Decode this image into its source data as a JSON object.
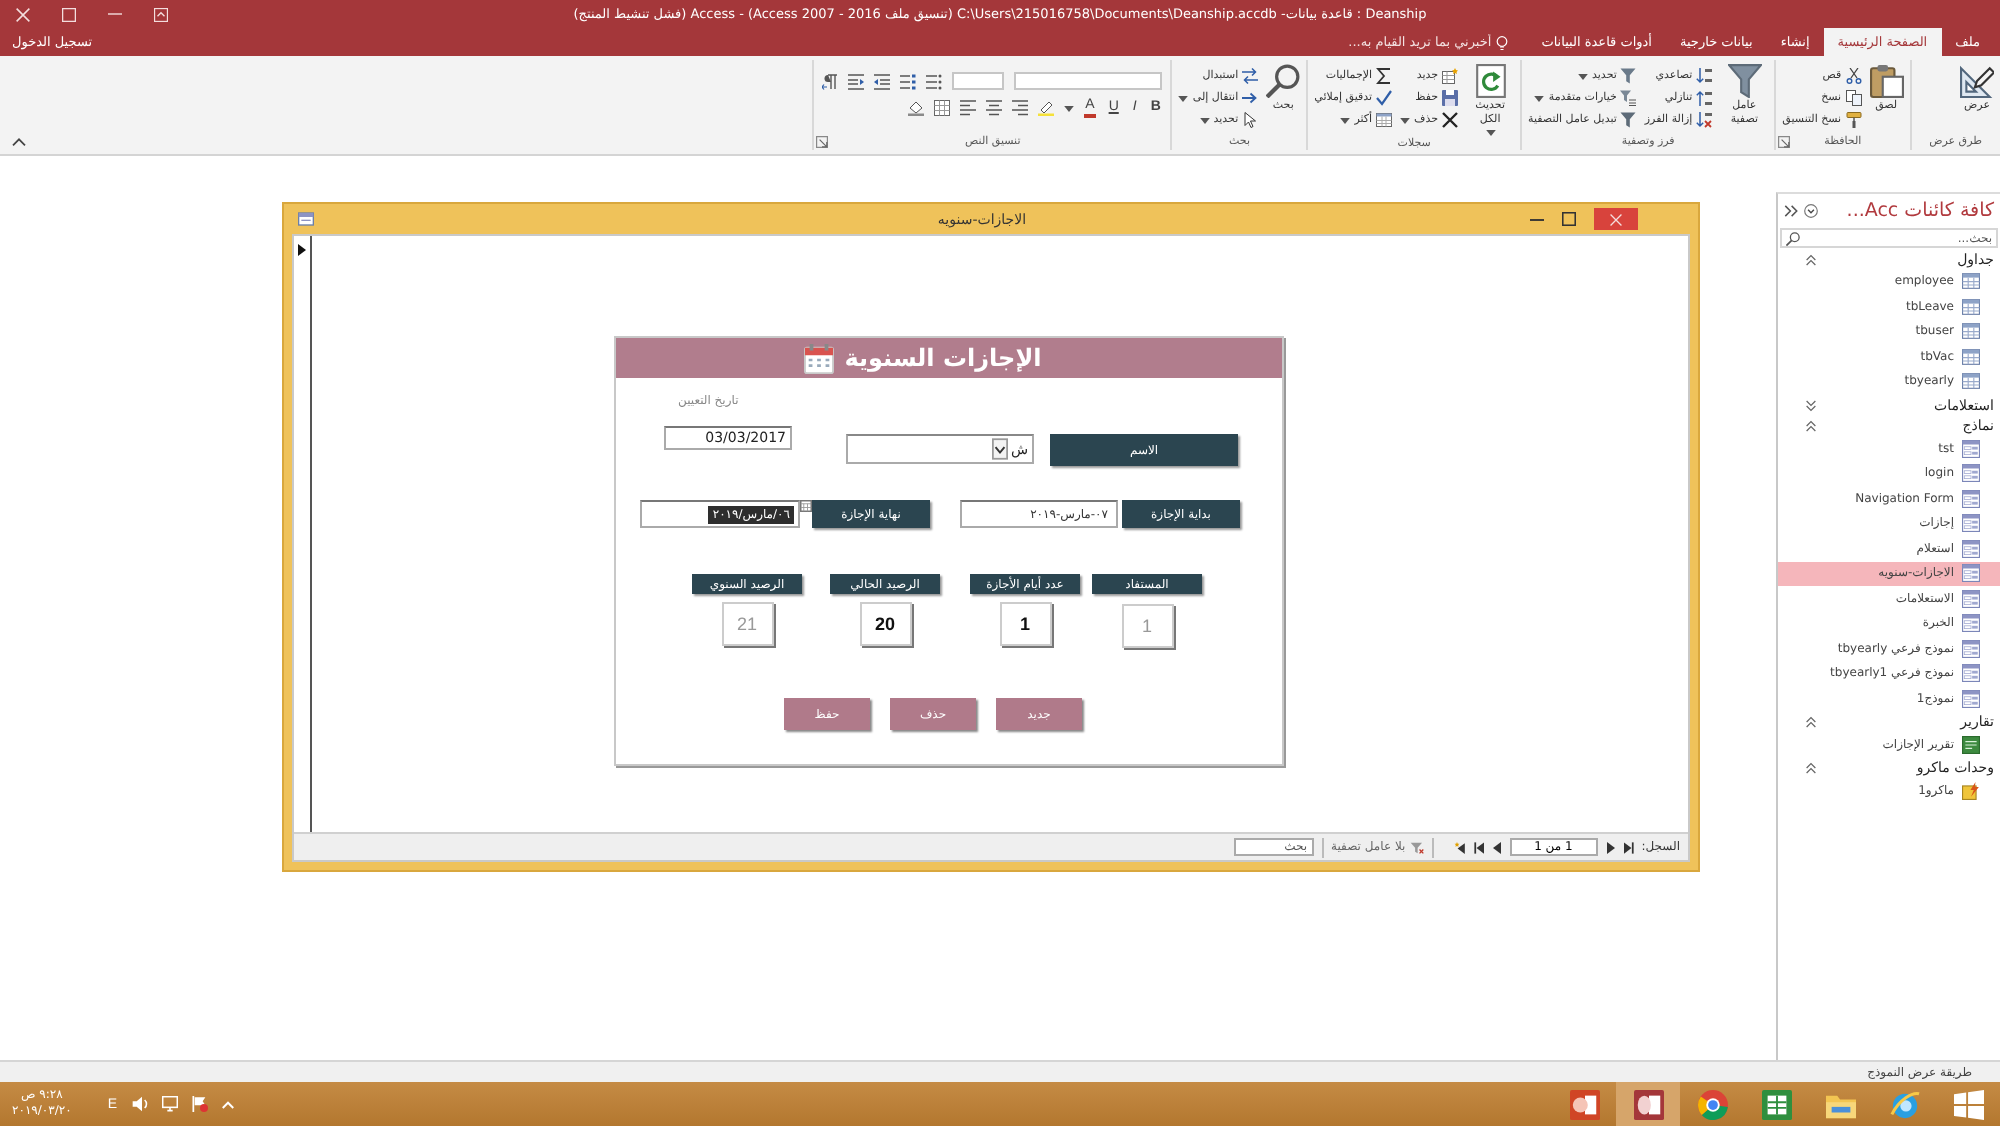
{
  "window": {
    "title": "Deanship : قاعدة بيانات- C:\\Users\\215016758\\Documents\\Deanship.accdb (تنسيق ملف Access 2007 - 2016) - Access (فشل تنشيط المنتج)",
    "sign_in": "تسجيل الدخول"
  },
  "ribbon_tabs": [
    {
      "label": "ملف",
      "selected": false
    },
    {
      "label": "الصفحة الرئيسية",
      "selected": true
    },
    {
      "label": "إنشاء",
      "selected": false
    },
    {
      "label": "بيانات خارجية",
      "selected": false
    },
    {
      "label": "أدوات قاعدة البيانات",
      "selected": false
    }
  ],
  "tell_me": {
    "placeholder": "أخبرني بما تريد القيام به..."
  },
  "ribbon": {
    "groups": [
      {
        "label": "طرق عرض",
        "launcher": false,
        "items": [
          {
            "kind": "large",
            "label": "عرض",
            "menu": false
          }
        ]
      },
      {
        "label": "الحافظة",
        "launcher": true,
        "items": [
          {
            "kind": "large",
            "label": "لصق",
            "menu": false
          },
          {
            "kind": "column",
            "commands": [
              {
                "label": "قص",
                "menu": false
              },
              {
                "label": "نسخ",
                "menu": false
              },
              {
                "label": "نسخ التنسيق",
                "menu": false
              }
            ]
          }
        ]
      },
      {
        "label": "فرز وتصفية",
        "launcher": false,
        "items": [
          {
            "kind": "large",
            "label": "عامل تصفية",
            "menu": false
          },
          {
            "kind": "column",
            "commands": [
              {
                "label": "تصاعدي",
                "menu": false
              },
              {
                "label": "تنازلي",
                "menu": false
              },
              {
                "label": "إزالة الفرز",
                "menu": false
              }
            ]
          },
          {
            "kind": "column",
            "commands": [
              {
                "label": "تحديد",
                "menu": true
              },
              {
                "label": "خيارات متقدمة",
                "menu": true
              },
              {
                "label": "تبديل عامل التصفية",
                "menu": false
              }
            ]
          }
        ]
      },
      {
        "label": "سجلات",
        "launcher": false,
        "items": [
          {
            "kind": "large",
            "label": "تحديث الكل",
            "menu": true
          },
          {
            "kind": "column",
            "commands": [
              {
                "label": "جديد",
                "menu": false
              },
              {
                "label": "حفظ",
                "menu": false
              },
              {
                "label": "حذف",
                "menu": true
              }
            ]
          },
          {
            "kind": "column",
            "commands": [
              {
                "label": "الإجماليات",
                "menu": false
              },
              {
                "label": "تدقيق إملائي",
                "menu": false
              },
              {
                "label": "أكثر",
                "menu": true
              }
            ]
          }
        ]
      },
      {
        "label": "بحث",
        "launcher": false,
        "items": [
          {
            "kind": "large",
            "label": "بحث",
            "menu": false
          },
          {
            "kind": "column",
            "commands": [
              {
                "label": "استبدال",
                "menu": false
              },
              {
                "label": "انتقال إلى",
                "menu": true
              },
              {
                "label": "تحديد",
                "menu": true
              }
            ]
          }
        ]
      },
      {
        "label": "تنسيق النص",
        "launcher": true,
        "items": [
          {
            "kind": "text_format",
            "buttons": [
              "B",
              "I",
              "U",
              "A"
            ]
          }
        ]
      }
    ]
  },
  "nav_pane": {
    "title": "كافة كائنات Acc...",
    "search_placeholder": "بحث...",
    "groups": [
      {
        "label": "جداول",
        "kind": "table",
        "expanded": true,
        "items": [
          {
            "label": "employee",
            "selected": false
          },
          {
            "label": "tbLeave",
            "selected": false
          },
          {
            "label": "tbuser",
            "selected": false
          },
          {
            "label": "tbVac",
            "selected": false
          },
          {
            "label": "tbyearly",
            "selected": false
          }
        ]
      },
      {
        "label": "استعلامات",
        "expanded": false
      },
      {
        "label": "نماذج",
        "kind": "form",
        "expanded": true,
        "items": [
          {
            "label": "tst",
            "selected": false
          },
          {
            "label": "login",
            "selected": false
          },
          {
            "label": "Navigation Form",
            "selected": false
          },
          {
            "label": "إجازات",
            "selected": false
          },
          {
            "label": "استعلام",
            "selected": false
          },
          {
            "label": "الاجازات-سنويه",
            "selected": true
          },
          {
            "label": "الاستعلامات",
            "selected": false
          },
          {
            "label": "الخبرة",
            "selected": false
          },
          {
            "label": "نموذج فرعي tbyearly",
            "selected": false
          },
          {
            "label": "نموذج فرعي tbyearly1",
            "selected": false
          },
          {
            "label": "نموذج1",
            "selected": false
          }
        ]
      },
      {
        "label": "تقارير",
        "kind": "report",
        "expanded": true,
        "items": [
          {
            "label": "تقرير الإجازات",
            "selected": false
          }
        ]
      },
      {
        "label": "وحدات ماكرو",
        "kind": "macro",
        "expanded": true,
        "items": [
          {
            "label": "ماكرو1",
            "selected": false
          }
        ]
      }
    ]
  },
  "form_window": {
    "title": "الاجازات-سنويه",
    "heading": "الإجازات السنوية",
    "hire_date": {
      "label": "تاريخ التعيين",
      "value": "03/03/2017"
    },
    "employee": {
      "label": "الاسم",
      "value": "ش"
    },
    "leave_dates": [
      {
        "label": "بداية الإجازة",
        "value": "٠٧-مارس-٢٠١٩",
        "text_selected": false,
        "date_picker": false
      },
      {
        "label": "نهاية الإجازة",
        "value": "٠٦/مارس/٢٠١٩",
        "text_selected": true,
        "date_picker": true
      }
    ],
    "balances": [
      {
        "label": "المستفاد",
        "value": "1",
        "disabled": true
      },
      {
        "label": "عدد أيام الأجازة",
        "value": "1",
        "disabled": false
      },
      {
        "label": "الرصيد الحالي",
        "value": "20",
        "disabled": false
      },
      {
        "label": "الرصيد السنوي",
        "value": "21",
        "disabled": true
      }
    ],
    "buttons": [
      "جديد",
      "حذف",
      "حفظ"
    ],
    "record_nav": {
      "label": "السجل:",
      "position": "1 من 1",
      "filter": "بلا عامل تصفية",
      "search_placeholder": "بحث"
    }
  },
  "status_bar": {
    "view": "طريقة عرض النموذج"
  },
  "taskbar": {
    "apps": [
      {
        "kind": "start",
        "selected": false
      },
      {
        "kind": "browser_e",
        "selected": false
      },
      {
        "kind": "folder",
        "selected": false
      },
      {
        "kind": "spreadsheet",
        "selected": false
      },
      {
        "kind": "browser_round",
        "selected": false
      },
      {
        "kind": "database",
        "selected": true
      },
      {
        "kind": "presentation",
        "selected": false
      }
    ],
    "language": "E",
    "time": "٩:٢٨ ص",
    "date": "٢٠١٩/٠٣/٢٠"
  }
}
